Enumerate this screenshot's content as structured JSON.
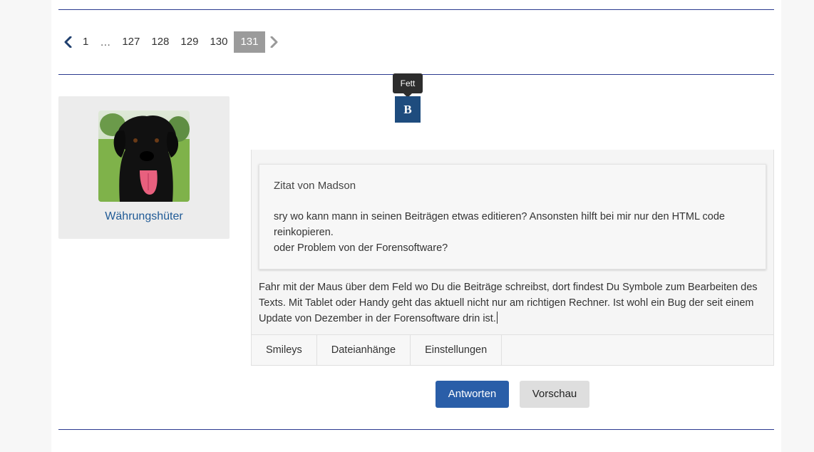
{
  "pagination": {
    "pages": [
      "1",
      "…",
      "127",
      "128",
      "129",
      "130",
      "131"
    ],
    "current": "131"
  },
  "user": {
    "name": "Währungshüter"
  },
  "toolbar": {
    "bold_tooltip": "Fett",
    "bold_label": "B"
  },
  "editor": {
    "quote_header": "Zitat von Madson",
    "quote_line1": "sry wo kann mann in seinen Beiträgen etwas editieren? Ansonsten hilft bei mir nur den HTML code reinkopieren.",
    "quote_line2": "oder Problem von der Forensoftware?",
    "reply_text": "Fahr mit der Maus über dem Feld wo Du die Beiträge schreibst, dort findest Du Symbole zum Bearbeiten des Texts. Mit Tablet oder Handy geht das aktuell nicht nur am richtigen Rechner. Ist wohl ein Bug der seit einem Update von Dezember in der Forensoftware drin ist.",
    "tabs": [
      "Smileys",
      "Dateianhänge",
      "Einstellungen"
    ]
  },
  "actions": {
    "reply_label": "Antworten",
    "preview_label": "Vorschau"
  },
  "colors": {
    "accent": "#2a5ea8",
    "rule": "#2b3a8f",
    "username": "#1f5a96"
  }
}
